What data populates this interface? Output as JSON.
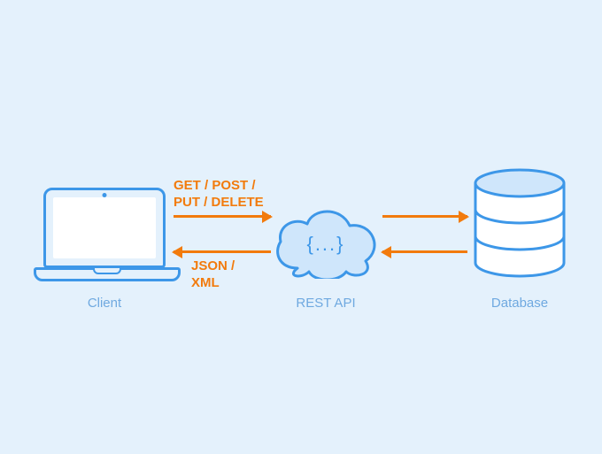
{
  "nodes": {
    "client": {
      "caption": "Client"
    },
    "api": {
      "caption": "REST API",
      "braces": "{...}"
    },
    "database": {
      "caption": "Database"
    }
  },
  "arrows": {
    "client_to_api": {
      "label": "GET / POST /\nPUT / DELETE"
    },
    "api_to_client": {
      "label": "JSON /\nXML"
    },
    "api_to_database": {
      "label": ""
    },
    "database_to_api": {
      "label": ""
    }
  }
}
